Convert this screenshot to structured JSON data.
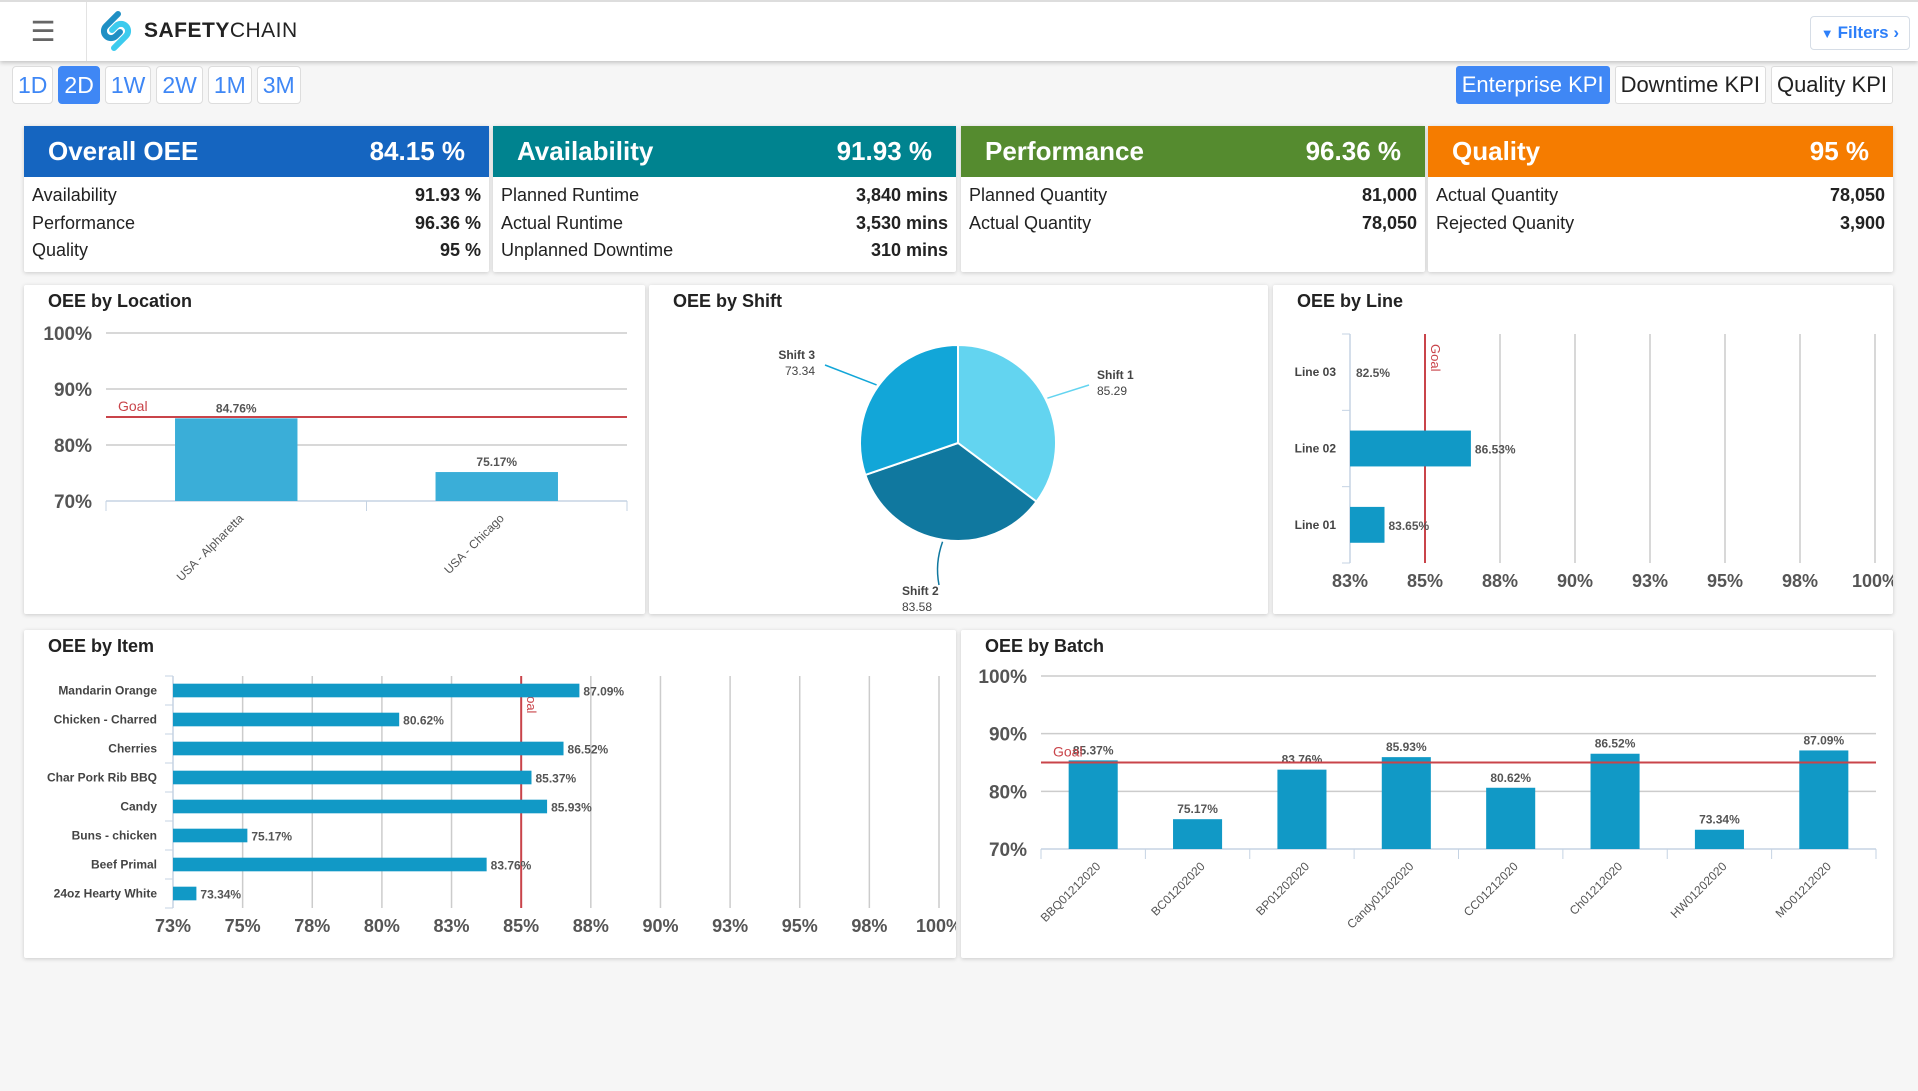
{
  "header": {
    "brand_bold": "SAFETY",
    "brand_rest": "CHAIN",
    "filters_label": "Filters ›",
    "menu_icon": "hamburger-icon",
    "filter_icon": "funnel-icon"
  },
  "ranges": [
    {
      "label": "1D",
      "active": false
    },
    {
      "label": "2D",
      "active": true
    },
    {
      "label": "1W",
      "active": false
    },
    {
      "label": "2W",
      "active": false
    },
    {
      "label": "1M",
      "active": false
    },
    {
      "label": "3M",
      "active": false
    }
  ],
  "kpi_tabs": [
    {
      "label": "Enterprise KPI",
      "active": true
    },
    {
      "label": "Downtime KPI",
      "active": false
    },
    {
      "label": "Quality KPI",
      "active": false
    }
  ],
  "kpis": [
    {
      "title": "Overall OEE",
      "value": "84.15 %",
      "color": "#1565c0",
      "rows": [
        [
          "Availability",
          "91.93 %"
        ],
        [
          "Performance",
          "96.36 %"
        ],
        [
          "Quality",
          "95 %"
        ]
      ]
    },
    {
      "title": "Availability",
      "value": "91.93 %",
      "color": "#00838f",
      "rows": [
        [
          "Planned Runtime",
          "3,840 mins"
        ],
        [
          "Actual Runtime",
          "3,530 mins"
        ],
        [
          "Unplanned Downtime",
          "310 mins"
        ]
      ]
    },
    {
      "title": "Performance",
      "value": "96.36 %",
      "color": "#558b2f",
      "rows": [
        [
          "Planned Quantity",
          "81,000"
        ],
        [
          "Actual Quantity",
          "78,050"
        ]
      ]
    },
    {
      "title": "Quality",
      "value": "95 %",
      "color": "#f57c00",
      "rows": [
        [
          "Actual Quantity",
          "78,050"
        ],
        [
          "Rejected Quanity",
          "3,900"
        ]
      ]
    }
  ],
  "chart_data": [
    {
      "id": "location",
      "type": "bar",
      "title": "OEE by Location",
      "categories": [
        "USA - Alpharetta",
        "USA - Chicago"
      ],
      "values": [
        84.76,
        75.17
      ],
      "labels": [
        "84.76%",
        "75.17%"
      ],
      "ylim": [
        70,
        100
      ],
      "yticks": [
        "70%",
        "80%",
        "90%",
        "100%"
      ],
      "goal": 85,
      "goal_label": "Goal",
      "color": "#3aaed8",
      "grid": true
    },
    {
      "id": "shift",
      "type": "pie",
      "title": "OEE by Shift",
      "categories": [
        "Shift 1",
        "Shift 2",
        "Shift 3"
      ],
      "values": [
        85.29,
        83.58,
        73.34
      ],
      "labels": [
        "85.29",
        "83.58",
        "73.34"
      ],
      "colors": [
        "#63d4f0",
        "#10789f",
        "#12a6d8"
      ]
    },
    {
      "id": "line",
      "type": "hbar",
      "title": "OEE by Line",
      "categories": [
        "Line 03",
        "Line 02",
        "Line 01"
      ],
      "values": [
        82.5,
        86.53,
        83.65
      ],
      "labels": [
        "82.5%",
        "86.53%",
        "83.65%"
      ],
      "xlim": [
        82.5,
        100
      ],
      "xticks": [
        "83%",
        "85%",
        "88%",
        "90%",
        "93%",
        "95%",
        "98%",
        "100%"
      ],
      "goal": 85,
      "goal_label": "Goal",
      "color": "#1199c6",
      "grid": true
    },
    {
      "id": "item",
      "type": "hbar",
      "title": "OEE by Item",
      "categories": [
        "Mandarin Orange",
        "Chicken - Charred",
        "Cherries",
        "Char Pork Rib BBQ",
        "Candy",
        "Buns - chicken",
        "Beef Primal",
        "24oz Hearty White"
      ],
      "values": [
        87.09,
        80.62,
        86.52,
        85.37,
        85.93,
        75.17,
        83.76,
        73.34
      ],
      "labels": [
        "87.09%",
        "80.62%",
        "86.52%",
        "85.37%",
        "85.93%",
        "75.17%",
        "83.76%",
        "73.34%"
      ],
      "xlim": [
        72.5,
        100
      ],
      "xticks": [
        "73%",
        "75%",
        "78%",
        "80%",
        "83%",
        "85%",
        "88%",
        "90%",
        "93%",
        "95%",
        "98%",
        "100%"
      ],
      "goal": 85,
      "goal_label": "Goal",
      "color": "#1199c6",
      "grid": true
    },
    {
      "id": "batch",
      "type": "bar",
      "title": "OEE by Batch",
      "categories": [
        "BBQ01212020",
        "BC01202020",
        "BP01202020",
        "Candy01202020",
        "CC01212020",
        "Ch01212020",
        "HW01202020",
        "MO01212020"
      ],
      "values": [
        85.37,
        75.17,
        83.76,
        85.93,
        80.62,
        86.52,
        73.34,
        87.09
      ],
      "labels": [
        "85.37%",
        "75.17%",
        "83.76%",
        "85.93%",
        "80.62%",
        "86.52%",
        "73.34%",
        "87.09%"
      ],
      "ylim": [
        70,
        100
      ],
      "yticks": [
        "70%",
        "80%",
        "90%",
        "100%"
      ],
      "goal": 85,
      "goal_label": "Goal",
      "color": "#1199c6",
      "grid": true
    }
  ]
}
